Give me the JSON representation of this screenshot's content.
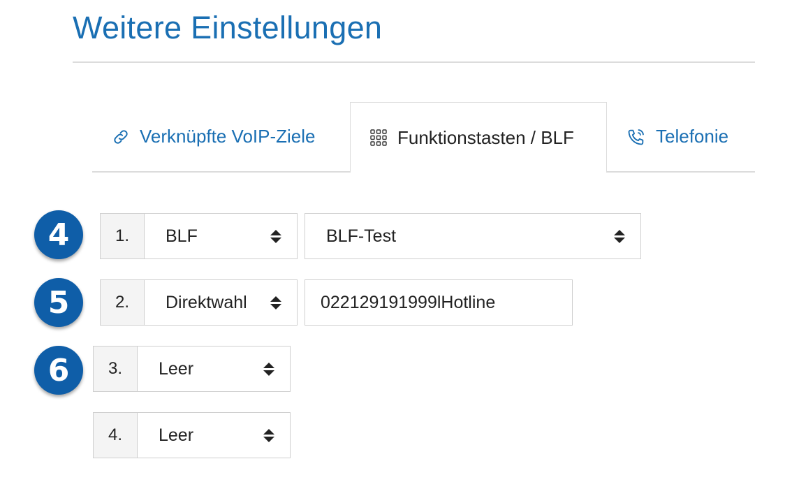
{
  "page": {
    "title": "Weitere Einstellungen"
  },
  "tabs": [
    {
      "label": "Verknüpfte VoIP-Ziele",
      "icon": "link-icon",
      "active": false
    },
    {
      "label": "Funktionstasten / BLF",
      "icon": "grid-icon",
      "active": true
    },
    {
      "label": "Telefonie",
      "icon": "phone-icon",
      "active": false
    }
  ],
  "badges": [
    "4",
    "5",
    "6"
  ],
  "keys": [
    {
      "number": "1.",
      "type": "BLF",
      "target": "BLF-Test"
    },
    {
      "number": "2.",
      "type": "Direktwahl",
      "value": "022129191999lHotline"
    },
    {
      "number": "3.",
      "type": "Leer"
    },
    {
      "number": "4.",
      "type": "Leer"
    }
  ],
  "colors": {
    "accent": "#1a6fb3",
    "badge": "#0f5ea8",
    "border": "#cfcfcf"
  }
}
